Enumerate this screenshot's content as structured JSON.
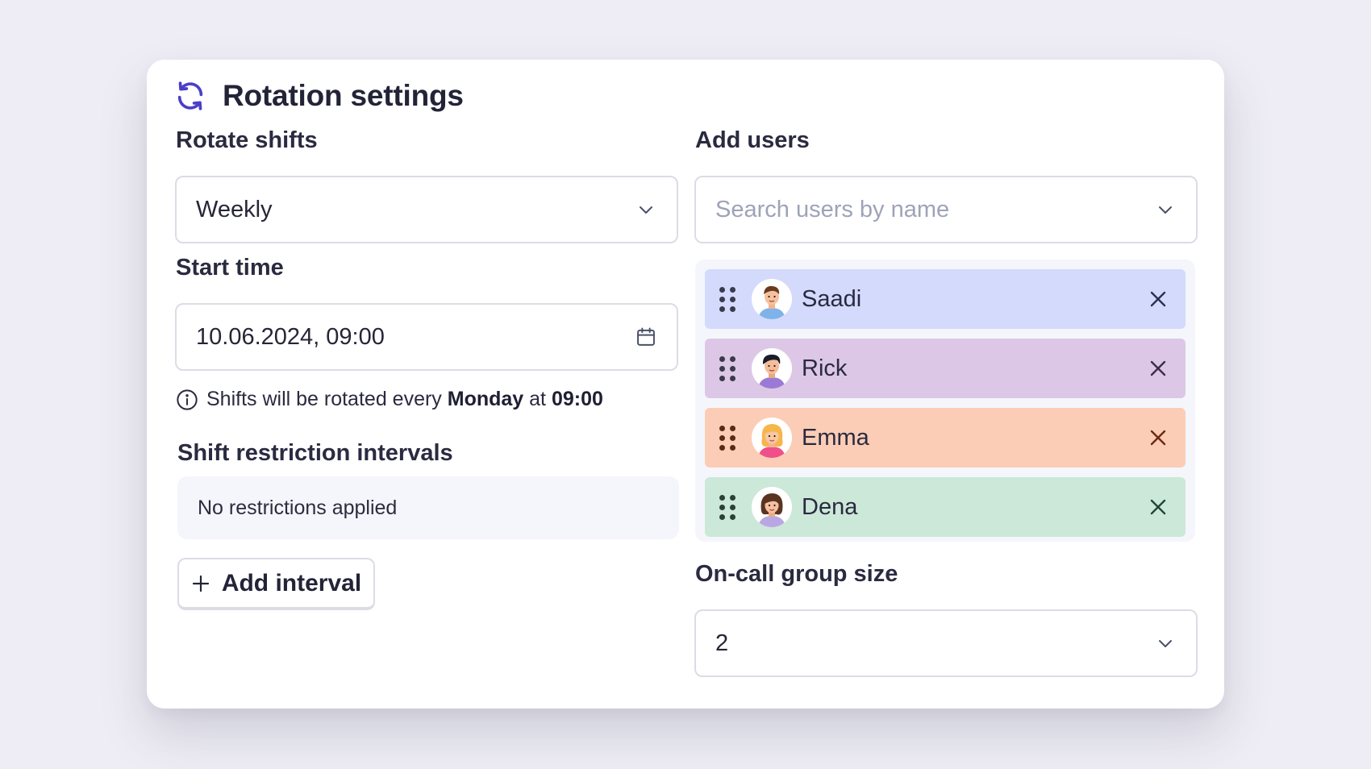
{
  "dialog": {
    "title": "Rotation settings",
    "icon": "rotate-icon",
    "accent_color": "#4b3fc9"
  },
  "rotate_shifts": {
    "label": "Rotate shifts",
    "value": "Weekly"
  },
  "start_time": {
    "label": "Start time",
    "value": "10.06.2024, 09:00"
  },
  "hint": {
    "prefix": "Shifts will be rotated every",
    "day": "Monday",
    "middle": "at",
    "time": "09:00"
  },
  "restrictions": {
    "label": "Shift restriction intervals",
    "empty_text": "No restrictions applied",
    "add_button": "Add interval"
  },
  "add_users": {
    "label": "Add users",
    "placeholder": "Search users by name"
  },
  "users": [
    {
      "name": "Saadi",
      "row_color": "#d4dafc",
      "remove_color": "#2e2f52"
    },
    {
      "name": "Rick",
      "row_color": "#ddc7e6",
      "remove_color": "#3c2e4a"
    },
    {
      "name": "Emma",
      "row_color": "#fbcdb6",
      "remove_color": "#6b2a12"
    },
    {
      "name": "Dena",
      "row_color": "#cce8d8",
      "remove_color": "#234537"
    }
  ],
  "group_size": {
    "label": "On-call group size",
    "value": "2"
  }
}
